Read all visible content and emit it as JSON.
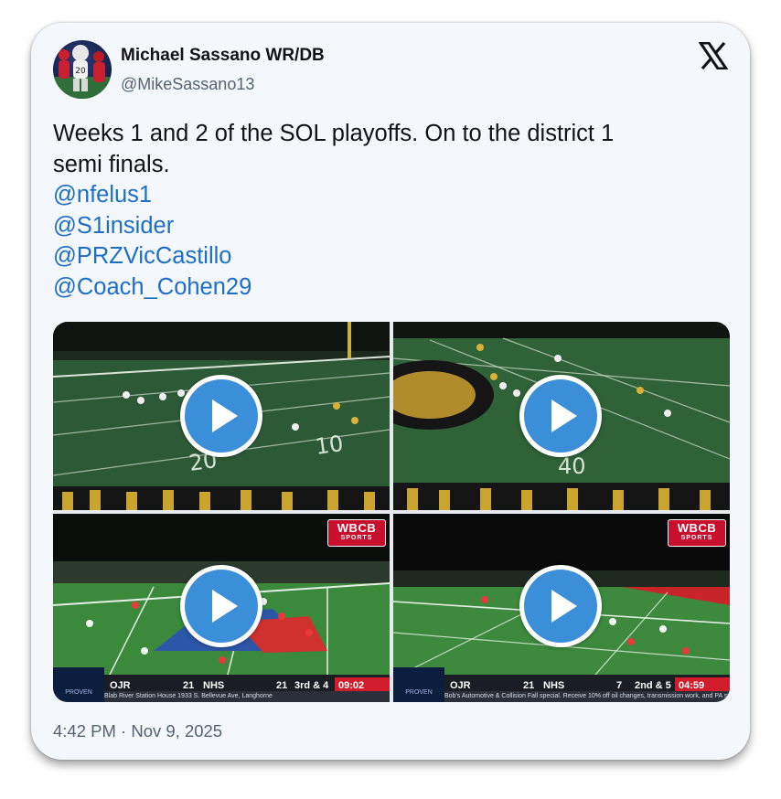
{
  "author": {
    "name": "Michael Sassano WR/DB",
    "handle": "@MikeSassano13"
  },
  "tweet": {
    "lines": [
      "Weeks 1 and 2 of the SOL playoffs. On to the district 1",
      "semi finals."
    ],
    "mentions": [
      "@nfelus1",
      "@S1insider",
      "@PRZVicCastillo",
      "@Coach_Cohen29"
    ]
  },
  "media": [
    {
      "kind": "video",
      "field_numbers": [
        "20",
        "10"
      ]
    },
    {
      "kind": "video",
      "field_numbers": [
        "40"
      ]
    },
    {
      "kind": "video",
      "network": {
        "name": "WBCB",
        "sub": "SPORTS"
      },
      "sponsor": "PROVEN",
      "scorebug": {
        "away": "OJR",
        "away_score": "21",
        "home": "NHS",
        "home_score": "21",
        "down": "3rd & 4",
        "clock": "09:02 3RD"
      },
      "ticker": "Blab River Station House 1933 S. Bellevue Ave, Langhorne"
    },
    {
      "kind": "video",
      "network": {
        "name": "WBCB",
        "sub": "SPORTS"
      },
      "sponsor": "PROVEN",
      "scorebug": {
        "away": "OJR",
        "away_score": "21",
        "home": "NHS",
        "home_score": "7",
        "down": "2nd & 5",
        "clock": "04:59 2ND"
      },
      "ticker": "Bob's Automotive & Collision Fall special. Receive 10% off oil changes, transmission work, and PA state inspection"
    }
  ],
  "timestamp": "4:42 PM · Nov 9, 2025",
  "colors": {
    "link": "#1d6fc5",
    "text": "#0f1419",
    "muted": "#536471",
    "play": "#3b8fd9",
    "network": "#c8102e"
  }
}
